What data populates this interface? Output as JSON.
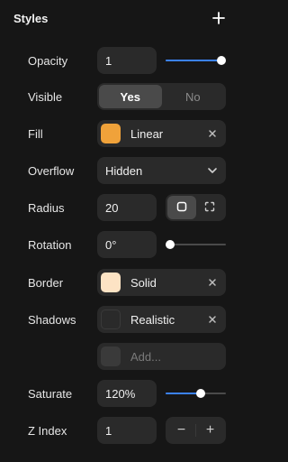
{
  "header": {
    "title": "Styles",
    "add_label": "+"
  },
  "opacity": {
    "label": "Opacity",
    "value": "1",
    "slider_fraction": 1.0
  },
  "visible": {
    "label": "Visible",
    "options": [
      "Yes",
      "No"
    ],
    "selected": "Yes"
  },
  "fill": {
    "label": "Fill",
    "value": "Linear",
    "swatch_color": "#f0a23a"
  },
  "overflow": {
    "label": "Overflow",
    "value": "Hidden"
  },
  "radius": {
    "label": "Radius",
    "value": "20"
  },
  "rotation": {
    "label": "Rotation",
    "value": "0°",
    "slider_fraction": 0.0
  },
  "border": {
    "label": "Border",
    "value": "Solid",
    "swatch_color": "#fde3c4"
  },
  "shadows": {
    "label": "Shadows",
    "value": "Realistic",
    "add_placeholder": "Add...",
    "swatch_color": "#2a2a2a"
  },
  "saturate": {
    "label": "Saturate",
    "value": "120%",
    "slider_fraction": 0.6
  },
  "zindex": {
    "label": "Z Index",
    "value": "1",
    "minus": "−",
    "plus": "+"
  },
  "colors": {
    "accent": "#3b82f6",
    "background": "#161616",
    "field": "#2a2a2a"
  }
}
